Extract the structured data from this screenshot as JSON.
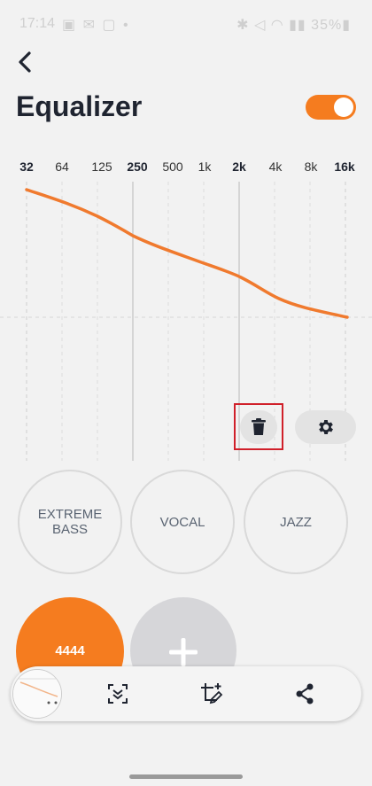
{
  "status_bar": {
    "time": "17:14",
    "left_icons": "▣ ✉ ▢ •",
    "right_icons": "✱ ◁ ◠ ▮▮ 35%▮"
  },
  "header": {
    "title": "Equalizer",
    "toggle_on": true
  },
  "equalizer": {
    "bands": [
      "32",
      "64",
      "125",
      "250",
      "500",
      "1k",
      "2k",
      "4k",
      "8k",
      "16k"
    ],
    "bold_bands": [
      "32",
      "250",
      "2k",
      "16k"
    ],
    "curve_color": "#f07a2e"
  },
  "actions": {
    "delete_icon": "trash-icon",
    "settings_icon": "gear-icon"
  },
  "presets": {
    "items": [
      "EXTREME BASS",
      "VOCAL",
      "JAZZ"
    ],
    "custom": "4444",
    "add_icon": "plus-icon"
  },
  "screenshot_toolbar": {
    "icons": [
      "scroll-capture-icon",
      "crop-edit-icon",
      "share-icon"
    ]
  },
  "colors": {
    "accent": "#f57c1f",
    "highlight": "#d0202a"
  }
}
